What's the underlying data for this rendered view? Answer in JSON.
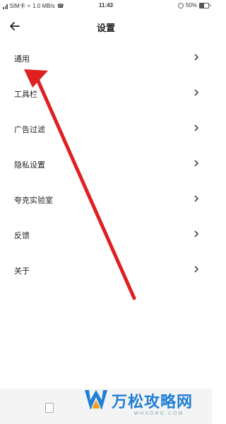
{
  "status_bar": {
    "carrier": "SIM卡",
    "net_speed": "1.0 MB/s",
    "time": "11:43",
    "battery": "50%",
    "battery_level": 0.5
  },
  "header": {
    "back_icon": "arrow-left-icon",
    "title": "设置"
  },
  "menu": {
    "items": [
      {
        "label": "通用"
      },
      {
        "label": "工具栏"
      },
      {
        "label": "广告过滤"
      },
      {
        "label": "隐私设置"
      },
      {
        "label": "夸克实验室"
      },
      {
        "label": "反馈"
      },
      {
        "label": "关于"
      }
    ],
    "chevron_icon": "chevron-right-icon"
  },
  "annotation": {
    "color": "#e02020"
  },
  "watermark": {
    "title": "万松攻略网",
    "subtitle": "WHSORG.COM",
    "color": "#1f7ed6"
  }
}
